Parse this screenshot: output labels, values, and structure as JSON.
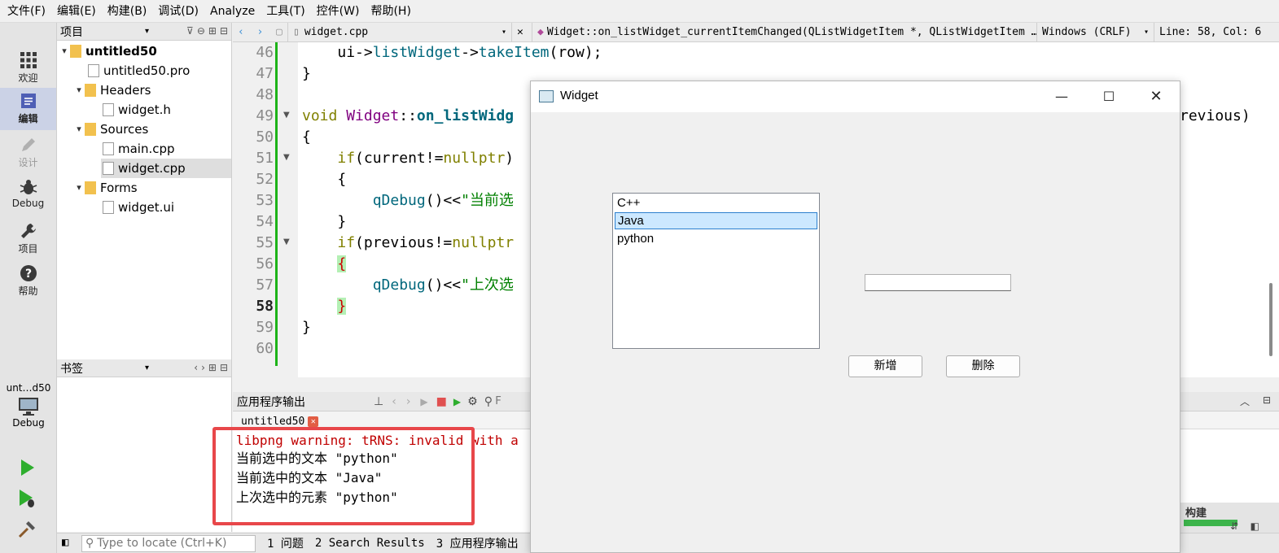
{
  "menu": [
    "文件(F)",
    "编辑(E)",
    "构建(B)",
    "调试(D)",
    "Analyze",
    "工具(T)",
    "控件(W)",
    "帮助(H)"
  ],
  "modes": {
    "welcome": "欢迎",
    "edit": "编辑",
    "design": "设计",
    "debug": "Debug",
    "projects": "项目",
    "help": "帮助"
  },
  "kit": {
    "project": "unt…d50",
    "mode": "Debug"
  },
  "project_panel": {
    "title": "项目",
    "tree": {
      "root": "untitled50",
      "pro_file": "untitled50.pro",
      "headers": "Headers",
      "header_file": "widget.h",
      "sources": "Sources",
      "source_main": "main.cpp",
      "source_widget": "widget.cpp",
      "forms": "Forms",
      "form_file": "widget.ui"
    }
  },
  "bookmarks_panel": {
    "title": "书签"
  },
  "editor_toolbar": {
    "file": "widget.cpp",
    "symbol": "Widget::on_listWidget_currentItemChanged(QListWidgetItem *, QListWidgetItem …",
    "line_ending": "Windows (CRLF)",
    "position": "Line: 58, Col: 6"
  },
  "editor": {
    "line_numbers": [
      "46",
      "47",
      "48",
      "49",
      "50",
      "51",
      "52",
      "53",
      "54",
      "55",
      "56",
      "57",
      "58",
      "59",
      "60"
    ],
    "current_line": "58",
    "code": {
      "l46_obj": "ui",
      "l46_arrow1": "->",
      "l46_member": "listWidget",
      "l46_arrow2": "->",
      "l46_fn": "takeItem",
      "l46_args": "(row);",
      "l47": "}",
      "l49_kw": "void",
      "l49_class": "Widget",
      "l49_sep": "::",
      "l49_fn": "on_listWidg",
      "l49_tail": "revious)",
      "l50": "{",
      "l51_kw": "if",
      "l51_open": "(current!=",
      "l51_kw2": "nullptr",
      "l51_close": ")",
      "l52": "{",
      "l53_fn": "qDebug",
      "l53_op": "()<<",
      "l53_str": "\"当前选",
      "l54": "}",
      "l55_kw": "if",
      "l55_open": "(previous!=",
      "l55_kw2": "nullptr",
      "l56": "{",
      "l57_fn": "qDebug",
      "l57_op": "()<<",
      "l57_str": "\"上次选",
      "l58": "}",
      "l59": "}"
    }
  },
  "output": {
    "title": "应用程序输出",
    "filter_placeholder": "F",
    "tab": "untitled50",
    "lines": [
      "libpng warning: tRNS: invalid with a",
      "当前选中的文本 \"python\"",
      "当前选中的文本 \"Java\"",
      "上次选中的元素 \"python\""
    ]
  },
  "statusbar": {
    "locate_placeholder": "Type to locate (Ctrl+K)",
    "issues": "1 问题",
    "search_results": "2 Search Results",
    "app_output": "3 应用程序输出"
  },
  "widget_window": {
    "title": "Widget",
    "list_items": [
      "C++",
      "Java",
      "python"
    ],
    "selected_item": "Java",
    "line_edit_value": "",
    "add_button": "新增",
    "delete_button": "删除"
  },
  "build": {
    "label": "构建",
    "progress": 1.0
  },
  "colors": {
    "change_bar": "#1db318",
    "selection": "#cce8ff",
    "highlight_box": "#e8474a",
    "warning_text": "#c00000"
  }
}
